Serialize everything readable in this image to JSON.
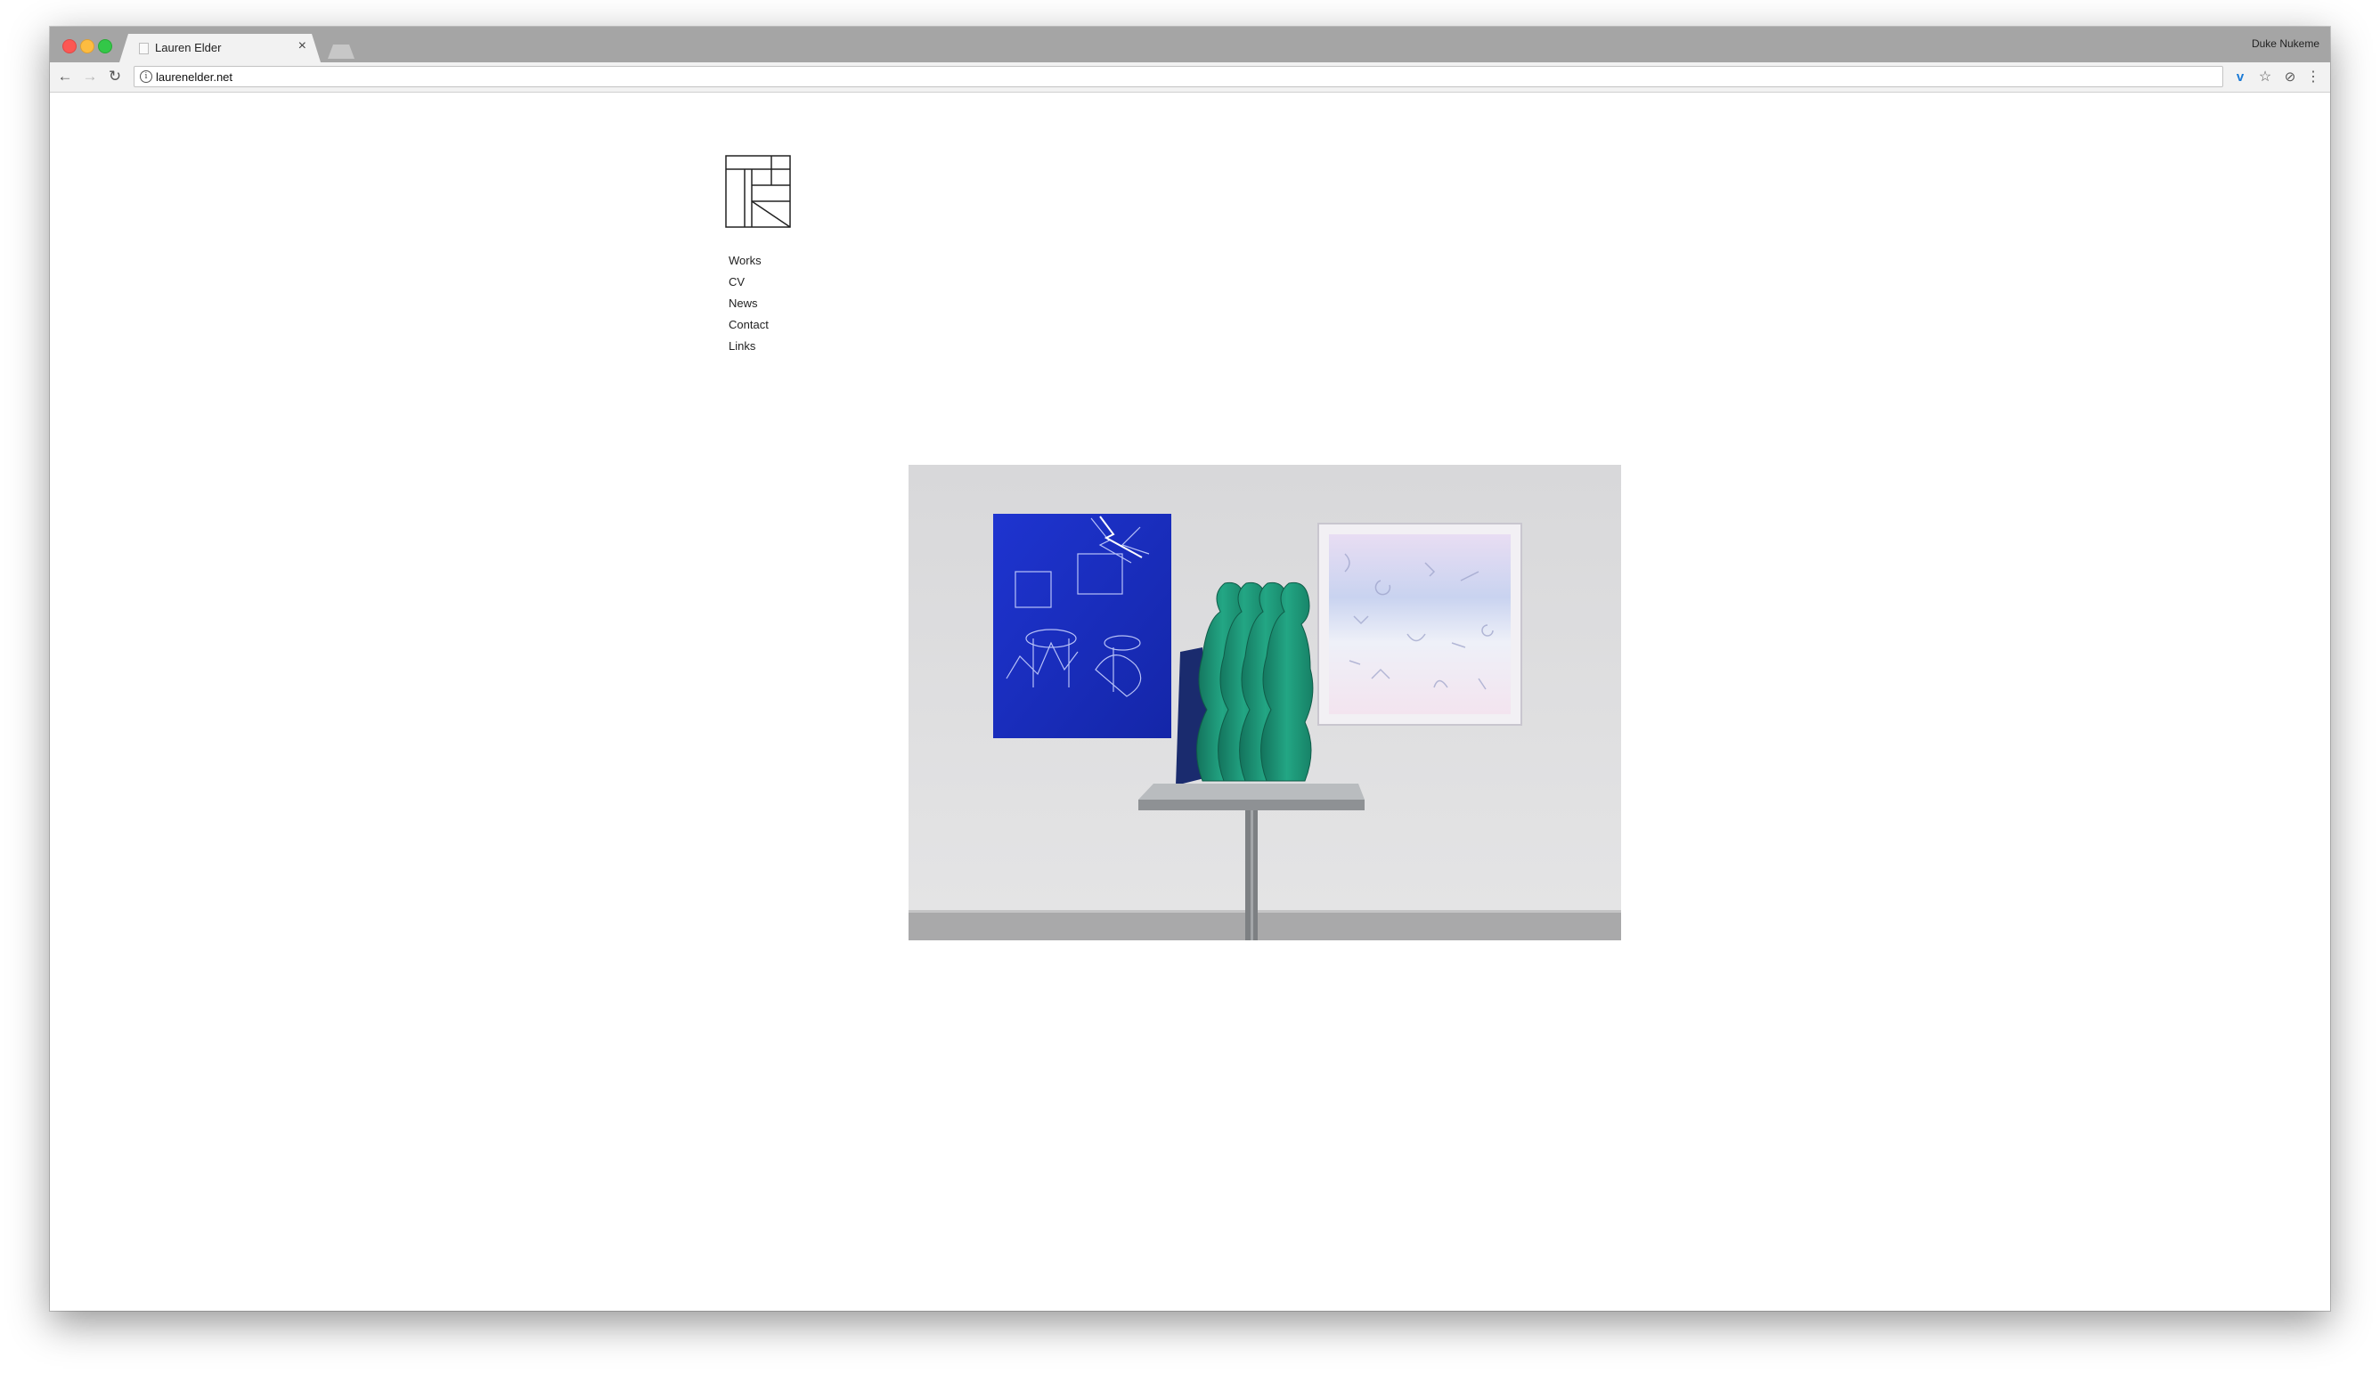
{
  "browser": {
    "tab": {
      "title": "Lauren Elder",
      "close_glyph": "×"
    },
    "profile_name": "Duke Nukeme",
    "address_bar": {
      "url": "laurenelder.net",
      "info_glyph": "i"
    },
    "buttons": {
      "back": "←",
      "forward": "→",
      "reload": "↻"
    },
    "extensions": [
      {
        "name": "vimeo-icon",
        "glyph": "v"
      },
      {
        "name": "star-icon",
        "glyph": "☆"
      },
      {
        "name": "shield-icon",
        "glyph": "⊘"
      },
      {
        "name": "menu-icon",
        "glyph": "⋮"
      }
    ]
  },
  "site": {
    "logo_icon": "monogram-logo-icon",
    "nav": [
      "Works",
      "CV",
      "News",
      "Contact",
      "Links"
    ],
    "featured_image": {
      "subject": "gallery installation photo",
      "colors": {
        "wall": "#dcdcdd",
        "blue_panel": "#1b2fc4",
        "green_sculpture": "#1f9c7c",
        "pastel_panel": "#e2dcf0",
        "floor": "#a8a8a8"
      }
    }
  }
}
